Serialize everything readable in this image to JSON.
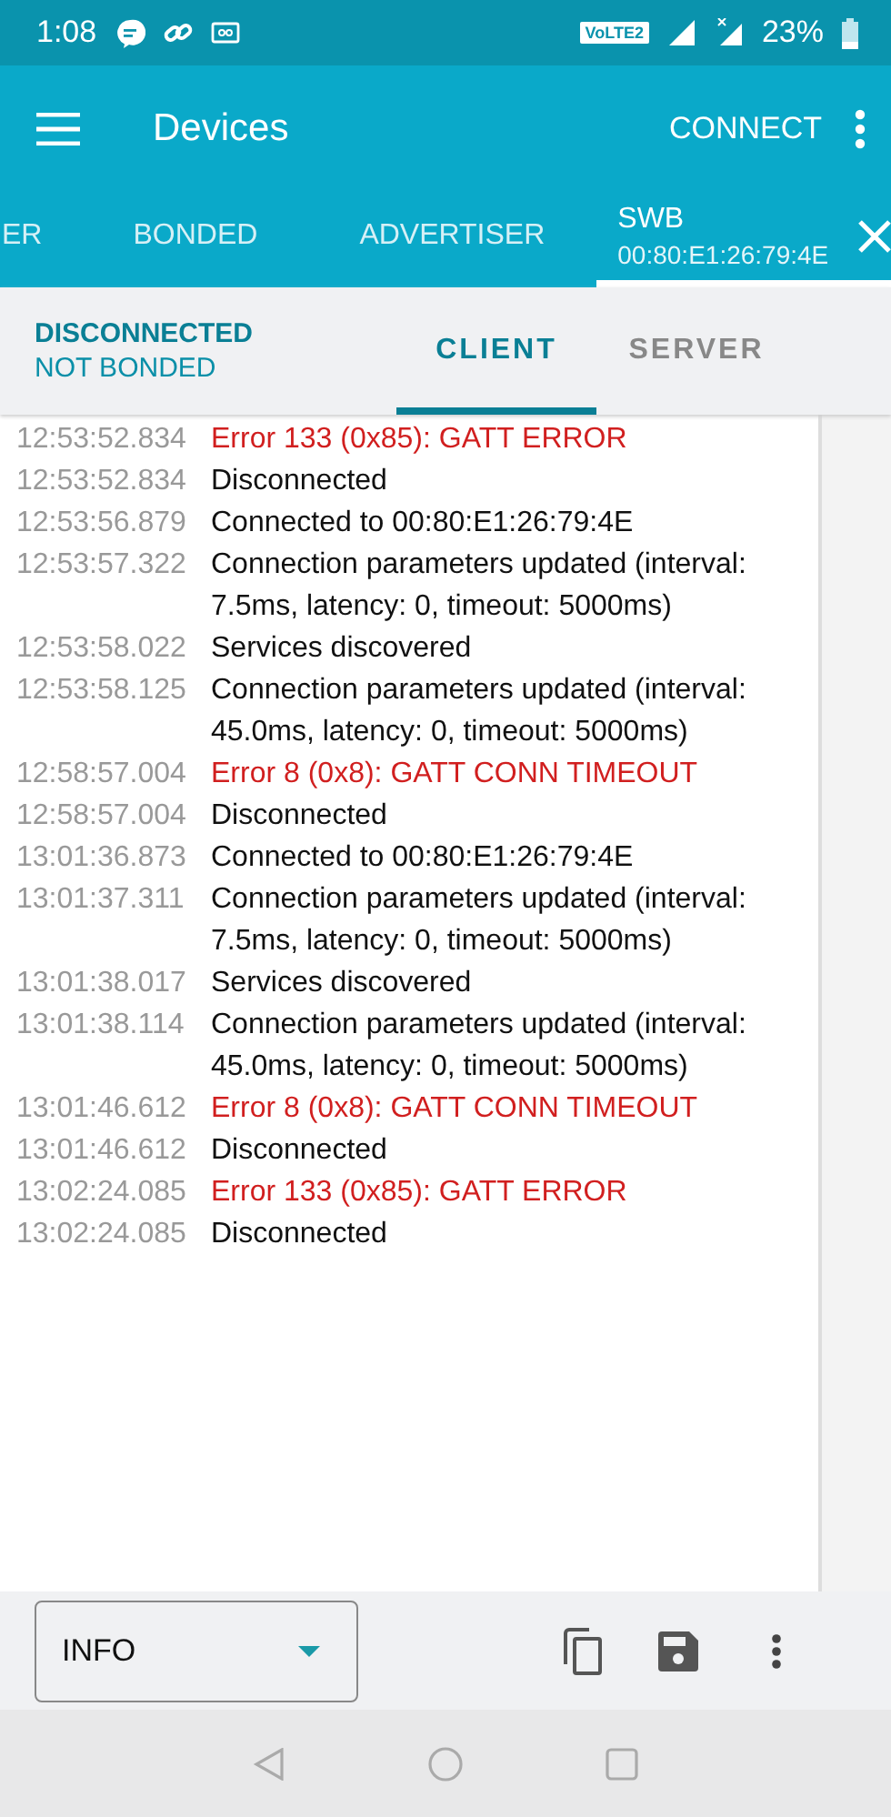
{
  "status_bar": {
    "time": "1:08",
    "network_badge": "VoLTE2",
    "battery": "23%"
  },
  "app_bar": {
    "title": "Devices",
    "action": "CONNECT"
  },
  "tabs": [
    {
      "label": "ER",
      "selected": false
    },
    {
      "label": "BONDED",
      "selected": false
    },
    {
      "label": "ADVERTISER",
      "selected": false
    },
    {
      "label": "SWB",
      "subtitle": "00:80:E1:26:79:4E",
      "selected": true
    }
  ],
  "connection": {
    "state": "DISCONNECTED",
    "bond": "NOT BONDED"
  },
  "role_tabs": [
    {
      "label": "CLIENT",
      "selected": true
    },
    {
      "label": "SERVER",
      "selected": false
    }
  ],
  "log": [
    {
      "time": "12:53:52.834",
      "message": "Error 133 (0x85): GATT ERROR",
      "kind": "error"
    },
    {
      "time": "12:53:52.834",
      "message": "Disconnected",
      "kind": "info"
    },
    {
      "time": "12:53:56.879",
      "message": "Connected to 00:80:E1:26:79:4E",
      "kind": "info"
    },
    {
      "time": "12:53:57.322",
      "message": "Connection parameters updated (interval: 7.5ms, latency: 0, timeout: 5000ms)",
      "kind": "info"
    },
    {
      "time": "12:53:58.022",
      "message": "Services discovered",
      "kind": "info"
    },
    {
      "time": "12:53:58.125",
      "message": "Connection parameters updated (interval: 45.0ms, latency: 0, timeout: 5000ms)",
      "kind": "info"
    },
    {
      "time": "12:58:57.004",
      "message": "Error 8 (0x8): GATT CONN TIMEOUT",
      "kind": "error"
    },
    {
      "time": "12:58:57.004",
      "message": "Disconnected",
      "kind": "info"
    },
    {
      "time": "13:01:36.873",
      "message": "Connected to 00:80:E1:26:79:4E",
      "kind": "info"
    },
    {
      "time": "13:01:37.311",
      "message": "Connection parameters updated (interval: 7.5ms, latency: 0, timeout: 5000ms)",
      "kind": "info"
    },
    {
      "time": "13:01:38.017",
      "message": "Services discovered",
      "kind": "info"
    },
    {
      "time": "13:01:38.114",
      "message": "Connection parameters updated (interval: 45.0ms, latency: 0, timeout: 5000ms)",
      "kind": "info"
    },
    {
      "time": "13:01:46.612",
      "message": "Error 8 (0x8): GATT CONN TIMEOUT",
      "kind": "error"
    },
    {
      "time": "13:01:46.612",
      "message": "Disconnected",
      "kind": "info"
    },
    {
      "time": "13:02:24.085",
      "message": "Error 133 (0x85): GATT ERROR",
      "kind": "error"
    },
    {
      "time": "13:02:24.085",
      "message": "Disconnected",
      "kind": "info"
    }
  ],
  "log_level": {
    "value": "INFO"
  }
}
